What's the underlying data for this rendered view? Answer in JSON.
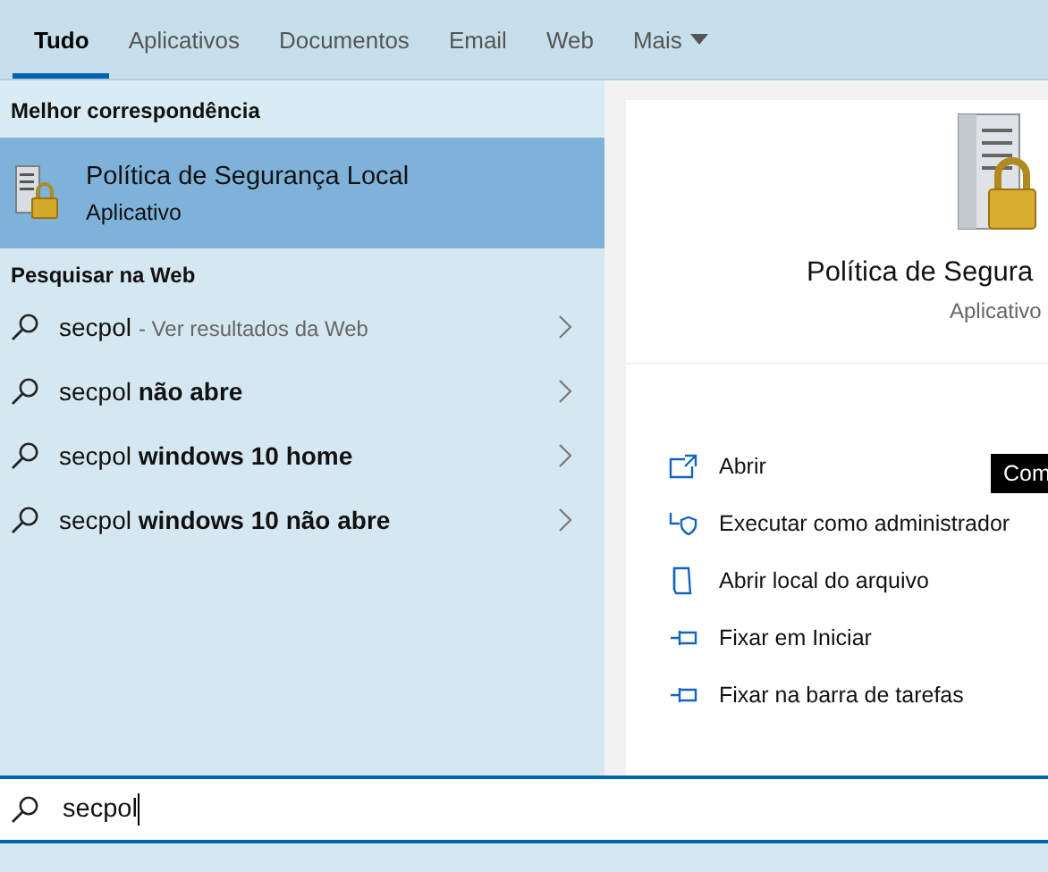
{
  "tabs": [
    {
      "label": "Tudo",
      "selected": true,
      "dropdown": false
    },
    {
      "label": "Aplicativos",
      "selected": false,
      "dropdown": false
    },
    {
      "label": "Documentos",
      "selected": false,
      "dropdown": false
    },
    {
      "label": "Email",
      "selected": false,
      "dropdown": false
    },
    {
      "label": "Web",
      "selected": false,
      "dropdown": false
    },
    {
      "label": "Mais",
      "selected": false,
      "dropdown": true
    }
  ],
  "best_match": {
    "heading": "Melhor correspondência",
    "items": [
      {
        "title": "Política de Segurança Local",
        "subtitle": "Aplicativo",
        "selected": true
      }
    ]
  },
  "web_search": {
    "heading": "Pesquisar na Web",
    "items": [
      {
        "query": "secpol",
        "hint": "- Ver resultados da Web"
      },
      {
        "query": "secpol **não abre**"
      },
      {
        "query": "secpol **windows 10 home**"
      },
      {
        "query": "secpol **windows 10 não abre**"
      }
    ]
  },
  "preview": {
    "title": "Política de Segura",
    "subtitle": "Aplicativo",
    "tooltip": "Com",
    "actions": [
      {
        "kind": "open",
        "label": "Abrir"
      },
      {
        "kind": "admin",
        "label": "Executar como administrador"
      },
      {
        "kind": "folder",
        "label": "Abrir local do arquivo"
      },
      {
        "kind": "pin",
        "label": "Fixar em Iniciar"
      },
      {
        "kind": "pin",
        "label": "Fixar na barra de tarefas"
      }
    ]
  },
  "search": {
    "value": "secpol"
  }
}
